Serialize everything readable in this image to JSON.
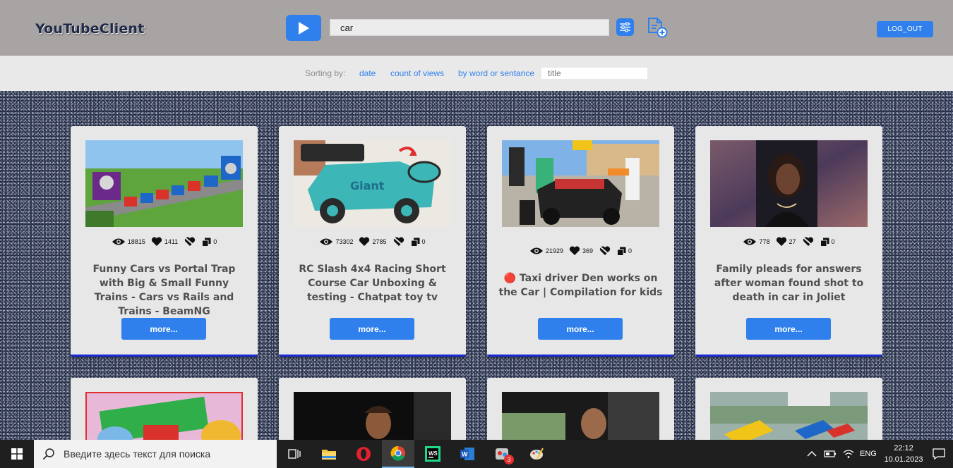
{
  "app": {
    "title": "YouTubeClient"
  },
  "header": {
    "search_value": "car",
    "logout_label": "LOG_OUT"
  },
  "sorting": {
    "label": "Sorting by:",
    "options": [
      "date",
      "count of views",
      "by word or sentance"
    ],
    "title_placeholder": "title"
  },
  "cards": [
    {
      "views": "18815",
      "likes": "1411",
      "dislikes": "",
      "comments": "0",
      "title": "Funny Cars vs Portal Trap with Big & Small Funny Trains - Cars vs Rails and Trains - BeamNG",
      "more_label": "more..."
    },
    {
      "views": "73302",
      "likes": "2785",
      "dislikes": "",
      "comments": "0",
      "title": "RC Slash 4x4 Racing Short Course Car Unboxing & testing - Chatpat toy tv",
      "more_label": "more..."
    },
    {
      "views": "21929",
      "likes": "369",
      "dislikes": "",
      "comments": "0",
      "title": "🔴 Taxi driver Den works on the Car | Compilation for kids",
      "more_label": "more..."
    },
    {
      "views": "778",
      "likes": "27",
      "dislikes": "",
      "comments": "0",
      "title": "Family pleads for answers after woman found shot to death in car in Joliet",
      "more_label": "more..."
    }
  ],
  "icons": {
    "play": "play-icon",
    "filter": "sliders-icon",
    "add_doc": "add-document-icon",
    "views": "eye-icon",
    "likes": "heart-icon",
    "dislikes": "heart-broken-icon",
    "comments": "copy-icon"
  },
  "taskbar": {
    "search_placeholder": "Введите здесь текст для поиска",
    "language": "ENG",
    "time": "22:12",
    "date": "10.01.2023",
    "notification_badge": "3"
  },
  "colors": {
    "accent": "#2f80ed",
    "header_bg": "#a8a4a4",
    "sortbar_bg": "#e9e9e9",
    "card_bg": "#e7e7e7",
    "card_border": "#1a2bd4",
    "title_text": "#4f4f4f"
  }
}
